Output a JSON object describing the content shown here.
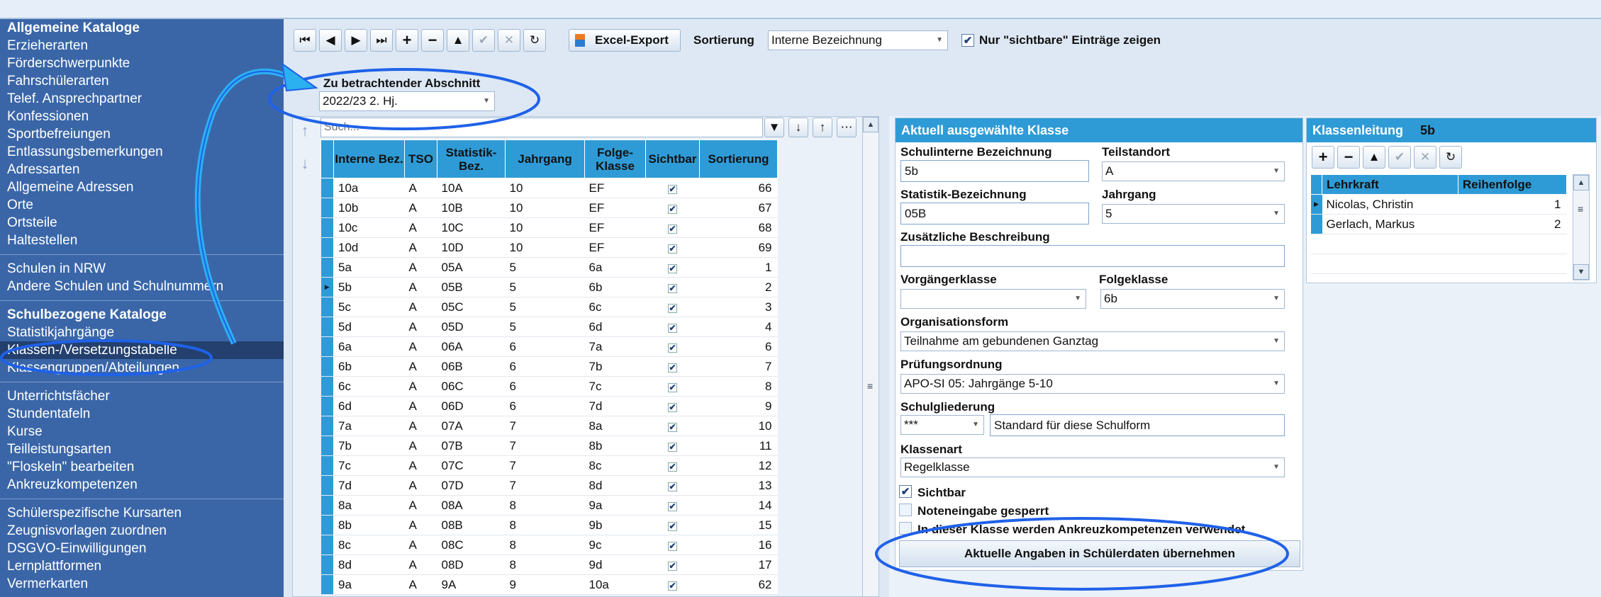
{
  "sidebar": {
    "groups": [
      {
        "title": "Allgemeine Kataloge",
        "items": [
          "Erzieherarten",
          "Förderschwerpunkte",
          "Fahrschülerarten",
          "Telef. Ansprechpartner",
          "Konfessionen",
          "Sportbefreiungen",
          "Entlassungsbemerkungen",
          "Adressarten",
          "Allgemeine Adressen",
          "Orte",
          "Ortsteile",
          "Haltestellen"
        ]
      },
      {
        "title": "",
        "items": [
          "Schulen in NRW",
          "Andere Schulen und Schulnummern"
        ]
      },
      {
        "title": "Schulbezogene Kataloge",
        "items": [
          "Statistikjahrgänge",
          "Klassen-/Versetzungstabelle",
          "Klassengruppen/Abteilungen"
        ]
      },
      {
        "title": "",
        "items": [
          "Unterrichtsfächer",
          "Stundentafeln",
          "Kurse",
          "Teilleistungsarten",
          "\"Floskeln\" bearbeiten",
          "Ankreuzkompetenzen"
        ]
      },
      {
        "title": "",
        "items": [
          "Schülerspezifische Kursarten",
          "Zeugnisvorlagen zuordnen",
          "DSGVO-Einwilligungen",
          "Lernplattformen",
          "Vermerkarten"
        ]
      }
    ],
    "selected": "Klassen-/Versetzungstabelle"
  },
  "toolbar": {
    "excel_label": "Excel-Export",
    "sort_label": "Sortierung",
    "sort_value": "Interne Bezeichnung",
    "visible_only_label": "Nur \"sichtbare\" Einträge zeigen",
    "visible_only_checked": true
  },
  "section": {
    "label": "Zu betrachtender Abschnitt",
    "value": "2022/23 2. Hj."
  },
  "filter": {
    "placeholder": "Such..."
  },
  "grid": {
    "columns": [
      "Interne Bez.",
      "TSO",
      "Statistik-\nBez.",
      "Jahrgang",
      "Folge-\nKlasse",
      "Sichtbar",
      "Sortierung"
    ],
    "rows": [
      [
        "10a",
        "A",
        "10A",
        "10",
        "EF",
        true,
        "66"
      ],
      [
        "10b",
        "A",
        "10B",
        "10",
        "EF",
        true,
        "67"
      ],
      [
        "10c",
        "A",
        "10C",
        "10",
        "EF",
        true,
        "68"
      ],
      [
        "10d",
        "A",
        "10D",
        "10",
        "EF",
        true,
        "69"
      ],
      [
        "5a",
        "A",
        "05A",
        "5",
        "6a",
        true,
        "1"
      ],
      [
        "5b",
        "A",
        "05B",
        "5",
        "6b",
        true,
        "2"
      ],
      [
        "5c",
        "A",
        "05C",
        "5",
        "6c",
        true,
        "3"
      ],
      [
        "5d",
        "A",
        "05D",
        "5",
        "6d",
        true,
        "4"
      ],
      [
        "6a",
        "A",
        "06A",
        "6",
        "7a",
        true,
        "6"
      ],
      [
        "6b",
        "A",
        "06B",
        "6",
        "7b",
        true,
        "7"
      ],
      [
        "6c",
        "A",
        "06C",
        "6",
        "7c",
        true,
        "8"
      ],
      [
        "6d",
        "A",
        "06D",
        "6",
        "7d",
        true,
        "9"
      ],
      [
        "7a",
        "A",
        "07A",
        "7",
        "8a",
        true,
        "10"
      ],
      [
        "7b",
        "A",
        "07B",
        "7",
        "8b",
        true,
        "11"
      ],
      [
        "7c",
        "A",
        "07C",
        "7",
        "8c",
        true,
        "12"
      ],
      [
        "7d",
        "A",
        "07D",
        "7",
        "8d",
        true,
        "13"
      ],
      [
        "8a",
        "A",
        "08A",
        "8",
        "9a",
        true,
        "14"
      ],
      [
        "8b",
        "A",
        "08B",
        "8",
        "9b",
        true,
        "15"
      ],
      [
        "8c",
        "A",
        "08C",
        "8",
        "9c",
        true,
        "16"
      ],
      [
        "8d",
        "A",
        "08D",
        "8",
        "9d",
        true,
        "17"
      ],
      [
        "9a",
        "A",
        "9A",
        "9",
        "10a",
        true,
        "62"
      ]
    ],
    "selected_row": 5
  },
  "detail": {
    "title": "Aktuell ausgewählte Klasse",
    "schulintern_label": "Schulinterne Bezeichnung",
    "schulintern_value": "5b",
    "teilstandort_label": "Teilstandort",
    "teilstandort_value": "A",
    "statistik_label": "Statistik-Bezeichnung",
    "statistik_value": "05B",
    "jahrgang_label": "Jahrgang",
    "jahrgang_value": "5",
    "beschreibung_label": "Zusätzliche Beschreibung",
    "beschreibung_value": "",
    "vorgaenger_label": "Vorgängerklasse",
    "vorgaenger_value": "",
    "folge_label": "Folgeklasse",
    "folge_value": "6b",
    "orgform_label": "Organisationsform",
    "orgform_value": "Teilnahme am gebundenen Ganztag",
    "pruefung_label": "Prüfungsordnung",
    "pruefung_value": "APO-SI 05: Jahrgänge 5-10",
    "gliederung_label": "Schulgliederung",
    "gliederung_code": "***",
    "gliederung_text": "Standard für diese Schulform",
    "klassenart_label": "Klassenart",
    "klassenart_value": "Regelklasse",
    "sichtbar_label": "Sichtbar",
    "sichtbar_checked": true,
    "noten_label": "Noteneingabe gesperrt",
    "noten_checked": false,
    "ankreuz_label": "In dieser Klasse werden Ankreuzkompetenzen verwendet",
    "ankreuz_checked": false,
    "apply_button": "Aktuelle Angaben in Schülerdaten übernehmen"
  },
  "klassenleitung": {
    "title": "Klassenleitung",
    "klasse": "5b",
    "columns": [
      "Lehrkraft",
      "Reihenfolge"
    ],
    "rows": [
      [
        "Nicolas, Christin",
        "1"
      ],
      [
        "Gerlach, Markus",
        "2"
      ]
    ]
  },
  "colors": {
    "sidebar": "#3a66a8",
    "header": "#2f9bd6",
    "highlight": "#1f61e8"
  }
}
